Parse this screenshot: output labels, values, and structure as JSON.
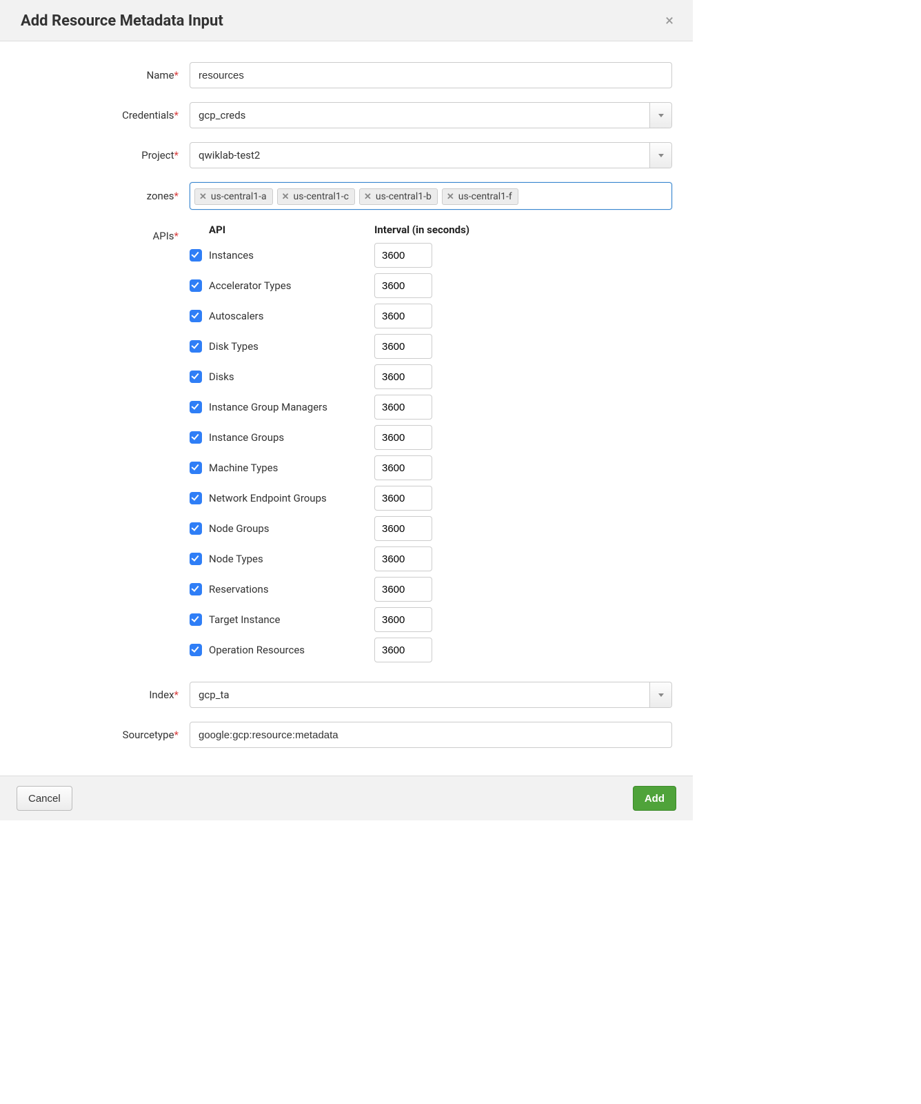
{
  "dialog": {
    "title": "Add Resource Metadata Input"
  },
  "labels": {
    "name": "Name",
    "credentials": "Credentials",
    "project": "Project",
    "zones": "zones",
    "apis": "APIs",
    "index": "Index",
    "sourcetype": "Sourcetype"
  },
  "values": {
    "name": "resources",
    "credentials": "gcp_creds",
    "project": "qwiklab-test2",
    "index": "gcp_ta",
    "sourcetype": "google:gcp:resource:metadata"
  },
  "zones": [
    "us-central1-a",
    "us-central1-c",
    "us-central1-b",
    "us-central1-f"
  ],
  "apiTable": {
    "headers": {
      "api": "API",
      "interval": "Interval (in seconds)"
    },
    "rows": [
      {
        "name": "Instances",
        "interval": "3600",
        "checked": true
      },
      {
        "name": "Accelerator Types",
        "interval": "3600",
        "checked": true
      },
      {
        "name": "Autoscalers",
        "interval": "3600",
        "checked": true
      },
      {
        "name": "Disk Types",
        "interval": "3600",
        "checked": true
      },
      {
        "name": "Disks",
        "interval": "3600",
        "checked": true
      },
      {
        "name": "Instance Group Managers",
        "interval": "3600",
        "checked": true
      },
      {
        "name": "Instance Groups",
        "interval": "3600",
        "checked": true
      },
      {
        "name": "Machine Types",
        "interval": "3600",
        "checked": true
      },
      {
        "name": "Network Endpoint Groups",
        "interval": "3600",
        "checked": true
      },
      {
        "name": "Node Groups",
        "interval": "3600",
        "checked": true
      },
      {
        "name": "Node Types",
        "interval": "3600",
        "checked": true
      },
      {
        "name": "Reservations",
        "interval": "3600",
        "checked": true
      },
      {
        "name": "Target Instance",
        "interval": "3600",
        "checked": true
      },
      {
        "name": "Operation Resources",
        "interval": "3600",
        "checked": true
      }
    ]
  },
  "footer": {
    "cancel": "Cancel",
    "add": "Add"
  }
}
